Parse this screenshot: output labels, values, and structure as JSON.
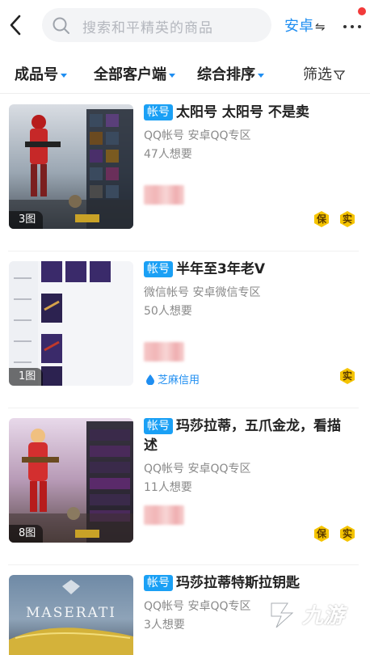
{
  "header": {
    "search_placeholder": "搜索和平精英的商品",
    "platform_label": "安卓",
    "platform_swap_icon": "⇋"
  },
  "filters": [
    {
      "label": "成品号"
    },
    {
      "label": "全部客户端"
    },
    {
      "label": "综合排序"
    },
    {
      "label": "筛选"
    }
  ],
  "colors": {
    "accent": "#1f8ef1",
    "tag": "#1aa0f5",
    "badge_gold": "#f5c400",
    "notify": "#f23a3a"
  },
  "items": [
    {
      "tag": "帐号",
      "title": "太阳号 太阳号 不是卖",
      "sub": "QQ帐号  安卓QQ专区",
      "want": "47人想要",
      "image_count": "3图",
      "badges": [
        "保",
        "实"
      ]
    },
    {
      "tag": "帐号",
      "title": "半年至3年老V",
      "sub": "微信帐号  安卓微信专区",
      "want": "50人想要",
      "image_count": "1图",
      "zhima": "芝麻信用",
      "badges": [
        "实"
      ]
    },
    {
      "tag": "帐号",
      "title": "玛莎拉蒂，五爪金龙，看描述",
      "sub": "QQ帐号  安卓QQ专区",
      "want": "11人想要",
      "image_count": "8图",
      "badges": [
        "保",
        "实"
      ]
    },
    {
      "tag": "帐号",
      "title": "玛莎拉蒂特斯拉钥匙",
      "sub": "QQ帐号  安卓QQ专区",
      "want": "3人想要",
      "thumb_text": "MASERATI"
    }
  ],
  "watermark": {
    "text": "九游"
  }
}
